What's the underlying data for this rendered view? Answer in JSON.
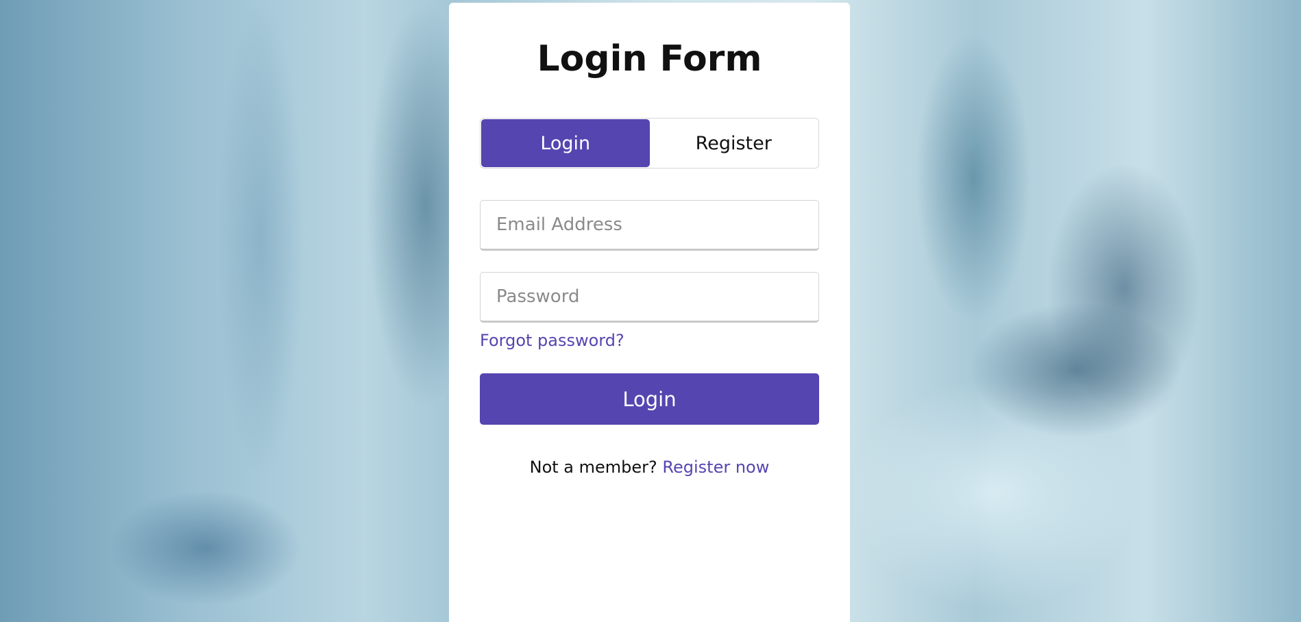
{
  "form": {
    "title": "Login Form",
    "tabs": [
      {
        "label": "Login",
        "active": true
      },
      {
        "label": "Register",
        "active": false
      }
    ],
    "email": {
      "placeholder": "Email Address",
      "value": ""
    },
    "password": {
      "placeholder": "Password",
      "value": ""
    },
    "forgot_link": "Forgot password?",
    "submit_label": "Login",
    "signup_prompt": "Not a member?",
    "signup_link": "Register now"
  },
  "colors": {
    "accent": "#5545b0",
    "card_background": "#ffffff",
    "text": "#111111"
  }
}
